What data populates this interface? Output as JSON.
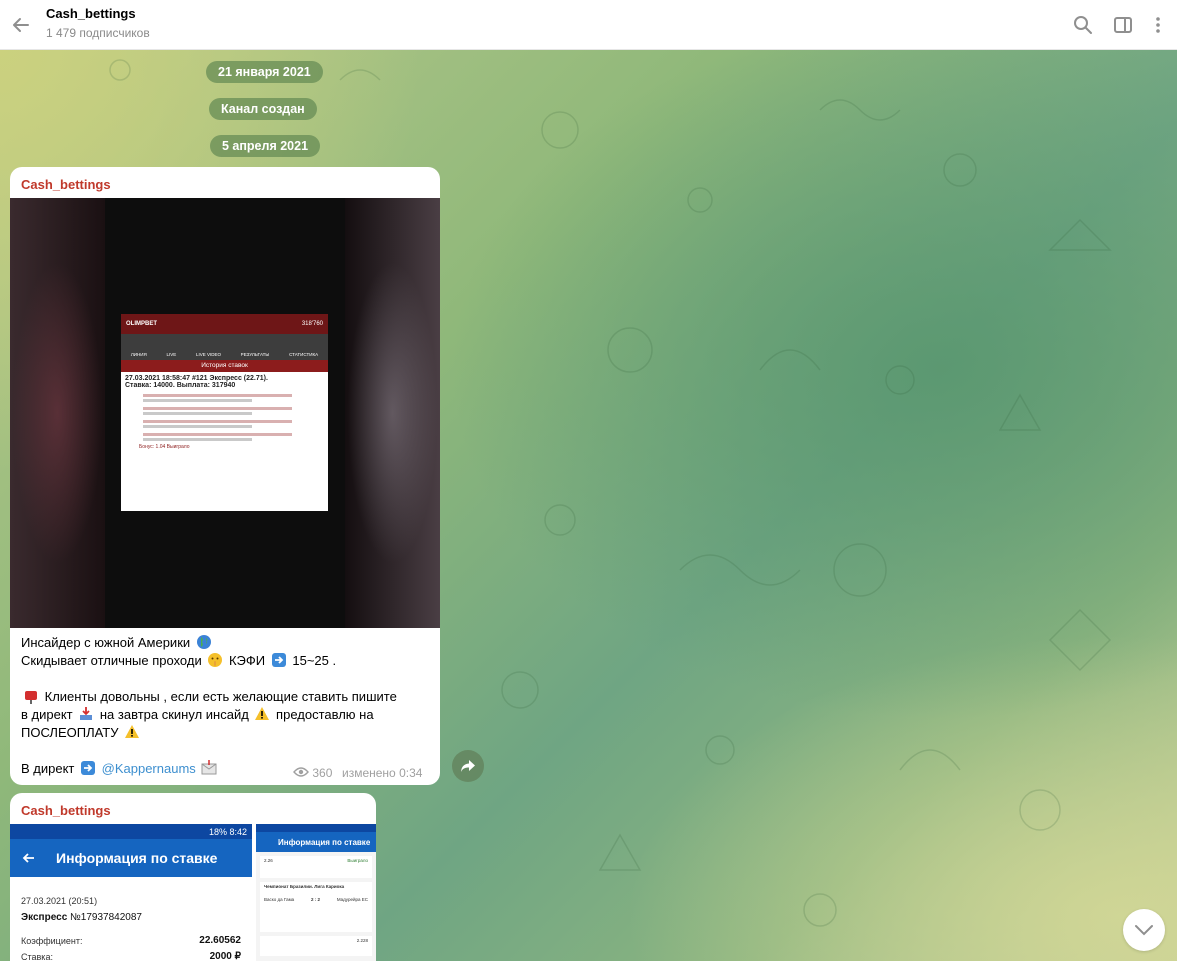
{
  "header": {
    "channel_title": "Cash_bettings",
    "subscribers": "1 479 подписчиков"
  },
  "date_pills": {
    "first": "21 января 2021",
    "service": "Канал создан",
    "second": "5 апреля 2021"
  },
  "post1": {
    "sender": "Cash_bettings",
    "screenshot": {
      "brand": "OLIMPBET",
      "balance": "318'760",
      "nav": [
        "ЛИНИЯ",
        "LIVE",
        "LIVE VIDEO",
        "РЕЗУЛЬТАТЫ",
        "СТАТИСТИКА"
      ],
      "history_title": "История ставок",
      "bet_line": "27.03.2021 18:58:47 #121 Экспресс (22.71).",
      "stake_line": "Ставка: 14000. Выплата: 317940",
      "bonus": "Бонус: 1.04 Выиграло"
    },
    "text_line1": "Инсайдер  с южной Америки",
    "text_line2a": "Скидывает  отличные проходи",
    "text_line2b": "КЭФИ",
    "text_line2c": "15~25 .",
    "text_line3": "Клиенты довольны , если есть  желающие  ставить  пишите",
    "text_line4a": "в директ",
    "text_line4b": "на  завтра  скинул  инсайд",
    "text_line4c": "предоставлю   на",
    "text_line5": "ПОСЛЕОПЛАТУ",
    "text_line6a": "В директ",
    "link": "@Kappernaums",
    "views": "360",
    "edited": "изменено 0:34"
  },
  "post2": {
    "sender": "Cash_bettings",
    "phone1": {
      "status": "18% 8:42",
      "appbar_title": "Информация по ставке",
      "date": "27.03.2021 (20:51)",
      "bet_name": "Экспресс",
      "bet_no": "№17937842087",
      "coef_label": "Коэффициент:",
      "coef_value": "22.60562",
      "stake_label": "Ставка:",
      "stake_value": "2000 ₽"
    },
    "phone2": {
      "appbar_title": "Информация по ставке",
      "league": "Чемпионат Бразилии. Лига Кариока",
      "team1": "Васко да Гама",
      "score": "2 : 2",
      "team2": "Мадурейра ЕС",
      "win": "Выиграло",
      "odds1": "2.26",
      "odds2": "2.228"
    }
  },
  "colors": {
    "sender": "#c0392b",
    "link": "#3d8fcf",
    "pill": "#678c55"
  },
  "icons": [
    "back-arrow-icon",
    "search-icon",
    "sidebar-toggle-icon",
    "more-vertical-icon",
    "eye-icon",
    "share-icon",
    "chevron-down-icon"
  ]
}
